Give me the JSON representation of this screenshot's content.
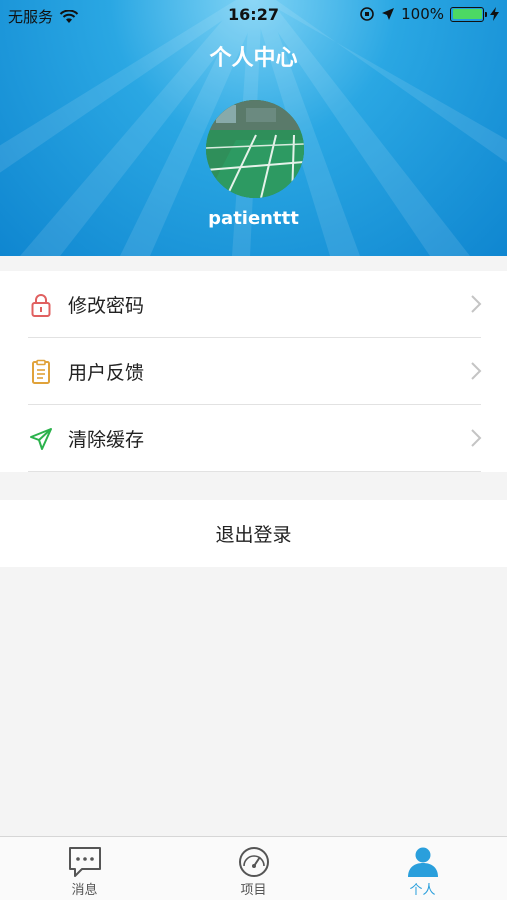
{
  "status_bar": {
    "carrier": "无服务",
    "time": "16:27",
    "battery": "100%"
  },
  "header": {
    "title": "个人中心",
    "username": "patienttt"
  },
  "menu": {
    "items": [
      {
        "label": "修改密码",
        "icon": "lock-icon"
      },
      {
        "label": "用户反馈",
        "icon": "document-icon"
      },
      {
        "label": "清除缓存",
        "icon": "paper-plane-icon"
      }
    ]
  },
  "logout": {
    "label": "退出登录"
  },
  "tabbar": {
    "tabs": [
      {
        "label": "消息",
        "icon": "chat-bubble-icon",
        "active": false
      },
      {
        "label": "项目",
        "icon": "gauge-icon",
        "active": false
      },
      {
        "label": "个人",
        "icon": "person-icon",
        "active": true
      }
    ]
  },
  "colors": {
    "header_blue": "#2aa7e3",
    "active_tab": "#2a9fdc",
    "lock_red": "#e06060",
    "doc_orange": "#e0a23a",
    "plane_green": "#2bb24c"
  }
}
